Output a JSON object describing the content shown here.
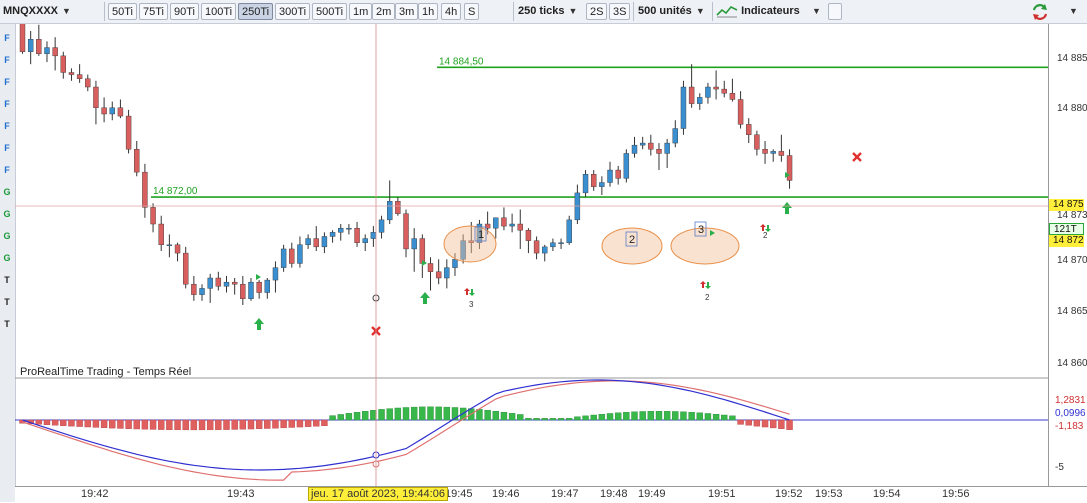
{
  "toolbar": {
    "instrument": "MNQXXXX",
    "intervals": [
      "50Ti",
      "75Ti",
      "90Ti",
      "100Ti",
      "250Ti",
      "300Ti",
      "500Ti",
      "1m",
      "2m",
      "3m",
      "1h",
      "4h",
      "S"
    ],
    "active_interval": "250Ti",
    "ticks_dropdown": "250 ticks",
    "seconds": [
      "2S",
      "3S"
    ],
    "units_dropdown": "500 unités",
    "indicators_label": "Indicateurs"
  },
  "left_tools": [
    "F",
    "F",
    "F",
    "F",
    "F",
    "F",
    "F",
    "G",
    "G",
    "G",
    "G",
    "T",
    "T",
    "T"
  ],
  "chart": {
    "watermark": "ProRealTime Trading - Temps Réel",
    "lines": [
      {
        "label": "14 884,50",
        "value": 14884.5,
        "color": "#1fa31f"
      },
      {
        "label": "14 872,00",
        "value": 14872.0,
        "color": "#1fa31f"
      }
    ],
    "crosshair_label": "jeu. 17 août 2023, 19:44:06",
    "pattern_labels": [
      "1",
      "2",
      "3"
    ],
    "signal_labels": [
      "3",
      "2",
      "2"
    ],
    "colors": {
      "up": "#3a8fd0",
      "down": "#d95f5f",
      "line": "#1fa31f"
    }
  },
  "price_axis": {
    "ticks": [
      "14 885",
      "14 880",
      "14 875",
      "14 873",
      "14 870",
      "14 865",
      "14 860"
    ],
    "current_price": "14 875",
    "tick_count": "121T",
    "level_label": "14 872"
  },
  "indicator_axis": {
    "ticks": [
      "1,2831",
      "0,0996",
      "-1,183",
      "-5"
    ]
  },
  "time_axis": {
    "labels": [
      "19:42",
      "19:43",
      "19:45",
      "19:46",
      "19:47",
      "19:48",
      "19:49",
      "19:51",
      "19:52",
      "19:53",
      "19:54",
      "19:56"
    ]
  },
  "chart_data": {
    "type": "candlestick",
    "instrument": "MNQXXXX",
    "interval": "250 ticks",
    "candles": [
      [
        14889.6,
        14889.8,
        14885.8,
        14886.0
      ],
      [
        14886.0,
        14888.0,
        14884.8,
        14887.2
      ],
      [
        14887.2,
        14888.6,
        14885.6,
        14885.8
      ],
      [
        14885.8,
        14887.0,
        14885.0,
        14886.4
      ],
      [
        14886.4,
        14887.4,
        14884.2,
        14885.6
      ],
      [
        14885.6,
        14886.0,
        14883.4,
        14884.0
      ],
      [
        14884.0,
        14884.4,
        14883.2,
        14883.8
      ],
      [
        14883.8,
        14884.8,
        14883.0,
        14883.4
      ],
      [
        14883.4,
        14883.8,
        14882.2,
        14882.6
      ],
      [
        14882.6,
        14883.2,
        14879.0,
        14880.6
      ],
      [
        14880.6,
        14881.6,
        14879.2,
        14880.0
      ],
      [
        14880.0,
        14881.2,
        14879.4,
        14880.6
      ],
      [
        14880.6,
        14881.4,
        14879.6,
        14879.8
      ],
      [
        14879.8,
        14880.4,
        14876.2,
        14876.6
      ],
      [
        14876.6,
        14877.4,
        14874.0,
        14874.4
      ],
      [
        14874.4,
        14875.2,
        14870.0,
        14871.0
      ],
      [
        14871.0,
        14871.4,
        14868.6,
        14869.4
      ],
      [
        14869.4,
        14870.2,
        14866.8,
        14867.4
      ],
      [
        14867.4,
        14868.4,
        14866.2,
        14867.4
      ],
      [
        14867.4,
        14867.6,
        14865.8,
        14866.6
      ],
      [
        14866.6,
        14867.2,
        14863.2,
        14863.6
      ],
      [
        14863.6,
        14864.4,
        14862.0,
        14862.6
      ],
      [
        14862.6,
        14863.6,
        14862.0,
        14863.2
      ],
      [
        14863.2,
        14864.6,
        14861.8,
        14864.2
      ],
      [
        14864.2,
        14864.8,
        14863.0,
        14863.4
      ],
      [
        14863.4,
        14864.4,
        14862.8,
        14863.8
      ],
      [
        14863.8,
        14864.2,
        14862.6,
        14863.6
      ],
      [
        14863.6,
        14864.4,
        14861.6,
        14862.2
      ],
      [
        14862.2,
        14864.2,
        14862.0,
        14863.8
      ],
      [
        14863.8,
        14864.0,
        14862.2,
        14862.8
      ],
      [
        14862.8,
        14864.2,
        14862.2,
        14864.0
      ],
      [
        14864.0,
        14865.8,
        14862.8,
        14865.2
      ],
      [
        14865.2,
        14867.4,
        14864.8,
        14867.0
      ],
      [
        14867.0,
        14867.6,
        14865.2,
        14865.6
      ],
      [
        14865.6,
        14868.2,
        14865.2,
        14867.4
      ],
      [
        14867.4,
        14868.4,
        14867.0,
        14868.0
      ],
      [
        14868.0,
        14869.2,
        14866.8,
        14867.2
      ],
      [
        14867.2,
        14868.6,
        14866.6,
        14868.2
      ],
      [
        14868.2,
        14868.8,
        14867.6,
        14868.6
      ],
      [
        14868.6,
        14869.4,
        14867.8,
        14869.0
      ],
      [
        14869.0,
        14869.4,
        14868.4,
        14869.0
      ],
      [
        14869.0,
        14869.6,
        14867.2,
        14867.6
      ],
      [
        14867.6,
        14868.4,
        14866.8,
        14868.0
      ],
      [
        14868.0,
        14869.2,
        14867.2,
        14868.6
      ],
      [
        14868.6,
        14870.2,
        14868.0,
        14869.8
      ],
      [
        14869.8,
        14873.6,
        14869.4,
        14871.6
      ],
      [
        14871.6,
        14872.0,
        14870.2,
        14870.4
      ],
      [
        14870.4,
        14870.8,
        14866.2,
        14867.0
      ],
      [
        14867.0,
        14869.0,
        14864.8,
        14868.0
      ],
      [
        14868.0,
        14868.4,
        14864.2,
        14865.6
      ],
      [
        14865.6,
        14866.2,
        14863.0,
        14864.8
      ],
      [
        14864.8,
        14866.0,
        14863.6,
        14864.2
      ],
      [
        14864.2,
        14866.0,
        14863.2,
        14865.2
      ],
      [
        14865.2,
        14866.6,
        14864.4,
        14866.0
      ],
      [
        14866.0,
        14868.4,
        14865.6,
        14867.8
      ],
      [
        14867.8,
        14869.6,
        14866.6,
        14867.6
      ],
      [
        14867.6,
        14869.8,
        14867.0,
        14869.4
      ],
      [
        14869.4,
        14870.6,
        14868.4,
        14869.0
      ],
      [
        14869.0,
        14870.0,
        14868.0,
        14870.0
      ],
      [
        14870.0,
        14871.0,
        14868.8,
        14869.2
      ],
      [
        14869.2,
        14870.4,
        14868.6,
        14869.4
      ],
      [
        14869.4,
        14870.8,
        14867.0,
        14868.8
      ],
      [
        14868.8,
        14869.0,
        14866.6,
        14867.8
      ],
      [
        14867.8,
        14868.2,
        14866.0,
        14866.6
      ],
      [
        14866.6,
        14867.4,
        14865.8,
        14867.2
      ],
      [
        14867.2,
        14868.0,
        14866.8,
        14867.6
      ],
      [
        14867.6,
        14868.0,
        14867.0,
        14867.6
      ],
      [
        14867.6,
        14870.2,
        14867.4,
        14869.8
      ],
      [
        14869.8,
        14873.2,
        14869.4,
        14872.4
      ],
      [
        14872.4,
        14874.6,
        14872.0,
        14874.2
      ],
      [
        14874.2,
        14874.6,
        14872.6,
        14873.0
      ],
      [
        14873.0,
        14874.0,
        14872.2,
        14873.4
      ],
      [
        14873.4,
        14875.4,
        14873.0,
        14874.6
      ],
      [
        14874.6,
        14875.0,
        14873.2,
        14873.8
      ],
      [
        14873.8,
        14876.6,
        14873.4,
        14876.2
      ],
      [
        14876.2,
        14877.8,
        14875.8,
        14877.0
      ],
      [
        14877.0,
        14877.8,
        14876.6,
        14877.2
      ],
      [
        14877.2,
        14878.0,
        14876.0,
        14876.6
      ],
      [
        14876.6,
        14877.2,
        14874.6,
        14876.2
      ],
      [
        14876.2,
        14877.6,
        14874.8,
        14877.2
      ],
      [
        14877.2,
        14879.4,
        14876.8,
        14878.6
      ],
      [
        14878.6,
        14883.2,
        14878.0,
        14882.6
      ],
      [
        14882.6,
        14884.8,
        14880.6,
        14881.0
      ],
      [
        14881.0,
        14882.0,
        14880.4,
        14881.6
      ],
      [
        14881.6,
        14883.0,
        14881.0,
        14882.6
      ],
      [
        14882.6,
        14884.2,
        14881.4,
        14882.4
      ],
      [
        14882.4,
        14883.2,
        14881.6,
        14882.0
      ],
      [
        14882.0,
        14883.4,
        14881.2,
        14881.4
      ],
      [
        14881.4,
        14882.2,
        14878.6,
        14879.0
      ],
      [
        14879.0,
        14879.6,
        14877.2,
        14878.0
      ],
      [
        14878.0,
        14878.4,
        14876.0,
        14876.6
      ],
      [
        14876.6,
        14877.4,
        14875.2,
        14876.2
      ],
      [
        14876.2,
        14876.6,
        14875.4,
        14876.4
      ],
      [
        14876.4,
        14878.0,
        14875.4,
        14876.0
      ],
      [
        14876.0,
        14876.6,
        14872.8,
        14873.6
      ]
    ],
    "horizontal_lines": [
      14884.5,
      14872.0
    ],
    "last_price": 14875,
    "indicator": {
      "type": "histogram_with_two_lines",
      "axis_ticks": [
        1.2831,
        0.0996,
        -1.183,
        -5
      ]
    }
  }
}
